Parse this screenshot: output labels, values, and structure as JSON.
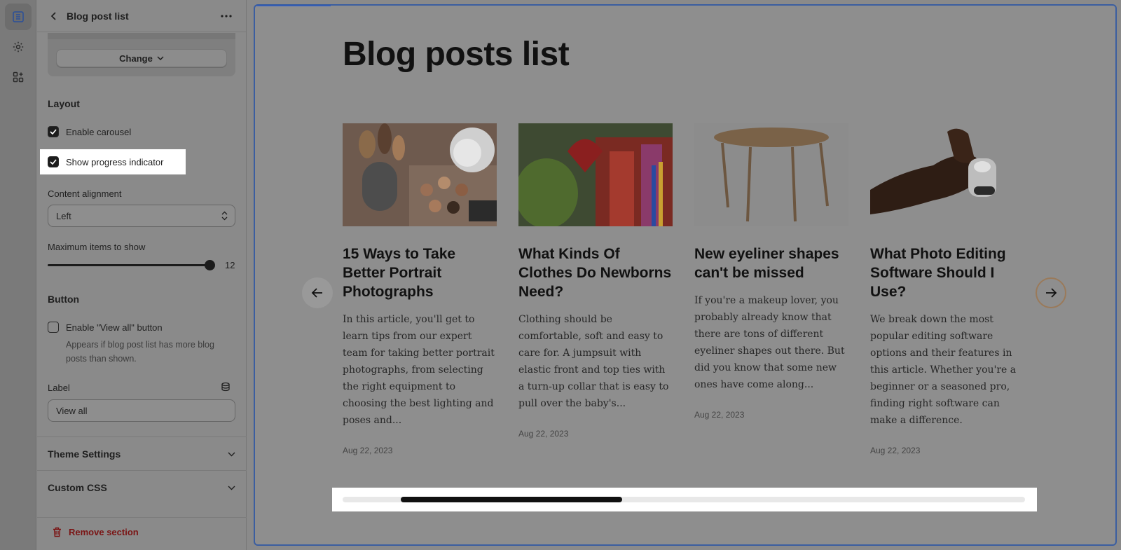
{
  "rail": {
    "items": [
      {
        "icon": "sections-icon",
        "active": true
      },
      {
        "icon": "gear-icon",
        "active": false
      },
      {
        "icon": "apps-icon",
        "active": false
      }
    ]
  },
  "panel": {
    "title": "Blog post list",
    "change_label": "Change",
    "layout_heading": "Layout",
    "enable_carousel": {
      "label": "Enable carousel",
      "checked": true
    },
    "show_progress": {
      "label": "Show progress indicator",
      "checked": true
    },
    "content_alignment": {
      "label": "Content alignment",
      "value": "Left"
    },
    "max_items": {
      "label": "Maximum items to show",
      "value": "12",
      "fraction": 1.0
    },
    "button_heading": "Button",
    "view_all": {
      "label": "Enable \"View all\" button",
      "checked": false,
      "help": "Appears if blog post list has more blog posts than shown."
    },
    "label_field": {
      "label": "Label",
      "value": "View all"
    },
    "theme_settings": "Theme Settings",
    "custom_css": "Custom CSS",
    "remove_section": "Remove section"
  },
  "preview": {
    "heading": "Blog posts list",
    "posts": [
      {
        "title": "15 Ways to Take Better Portrait Photographs",
        "excerpt": "In this article, you'll get to learn tips from our expert team for taking better portrait photographs, from selecting the right equipment to choosing the best lighting and poses and...",
        "date": "Aug 22, 2023",
        "image": "makeup-brushes-image"
      },
      {
        "title": "What Kinds Of Clothes Do Newborns Need?",
        "excerpt": "Clothing should be comfortable, soft and easy to care for. A jumpsuit with elastic front and top ties with a turn-up collar that is easy to pull over the baby's...",
        "date": "Aug 22, 2023",
        "image": "kimono-fan-image"
      },
      {
        "title": "New eyeliner shapes can't be missed",
        "excerpt": "If you're a makeup lover, you probably already know that there are tons of different eyeliner shapes out there. But did you know that some new ones have come along...",
        "date": "Aug 22, 2023",
        "image": "wooden-table-image"
      },
      {
        "title": "What Photo Editing Software Should I Use?",
        "excerpt": "We break down the most popular editing software options and their features in this article. Whether you're a beginner or a seasoned pro, finding right software can make a difference.",
        "date": "Aug 22, 2023",
        "image": "earbuds-hand-image"
      }
    ],
    "progress": {
      "start": 0.085,
      "end": 0.41
    }
  },
  "colors": {
    "accent": "#2a5bd7",
    "danger": "#7a1414",
    "overlay": "#8a8a8a"
  }
}
